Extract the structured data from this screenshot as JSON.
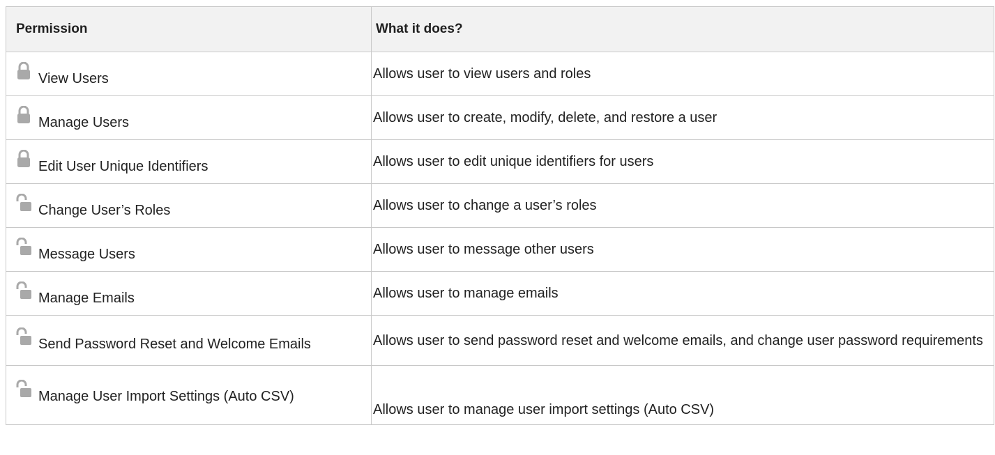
{
  "table": {
    "headers": {
      "permission": "Permission",
      "description": "What it does?"
    },
    "colors": {
      "lock_icon": "#a9a9a9",
      "header_bg": "#f2f2f2",
      "border": "#c8c8c8"
    },
    "rows": [
      {
        "icon": "lock-closed-icon",
        "permission": "View Users",
        "description": "Allows user to view users and roles"
      },
      {
        "icon": "lock-closed-icon",
        "permission": "Manage Users",
        "description": "Allows user to create, modify, delete, and restore a user"
      },
      {
        "icon": "lock-closed-icon",
        "permission": "Edit User Unique Identifiers",
        "description": "Allows user to edit unique identifiers for users"
      },
      {
        "icon": "lock-open-icon",
        "permission": "Change User’s Roles",
        "description": "Allows user to change a user’s roles"
      },
      {
        "icon": "lock-open-icon",
        "permission": "Message Users",
        "description": "Allows user to message other users"
      },
      {
        "icon": "lock-open-icon",
        "permission": "Manage Emails",
        "description": "Allows user to manage emails"
      },
      {
        "icon": "lock-open-icon",
        "permission": "Send Password Reset and Welcome Emails",
        "description": "Allows user to send password reset and welcome emails, and change user password requirements"
      },
      {
        "icon": "lock-open-icon",
        "permission": "Manage User Import Settings (Auto CSV)",
        "description": "Allows user to manage user import settings (Auto CSV)"
      }
    ]
  }
}
